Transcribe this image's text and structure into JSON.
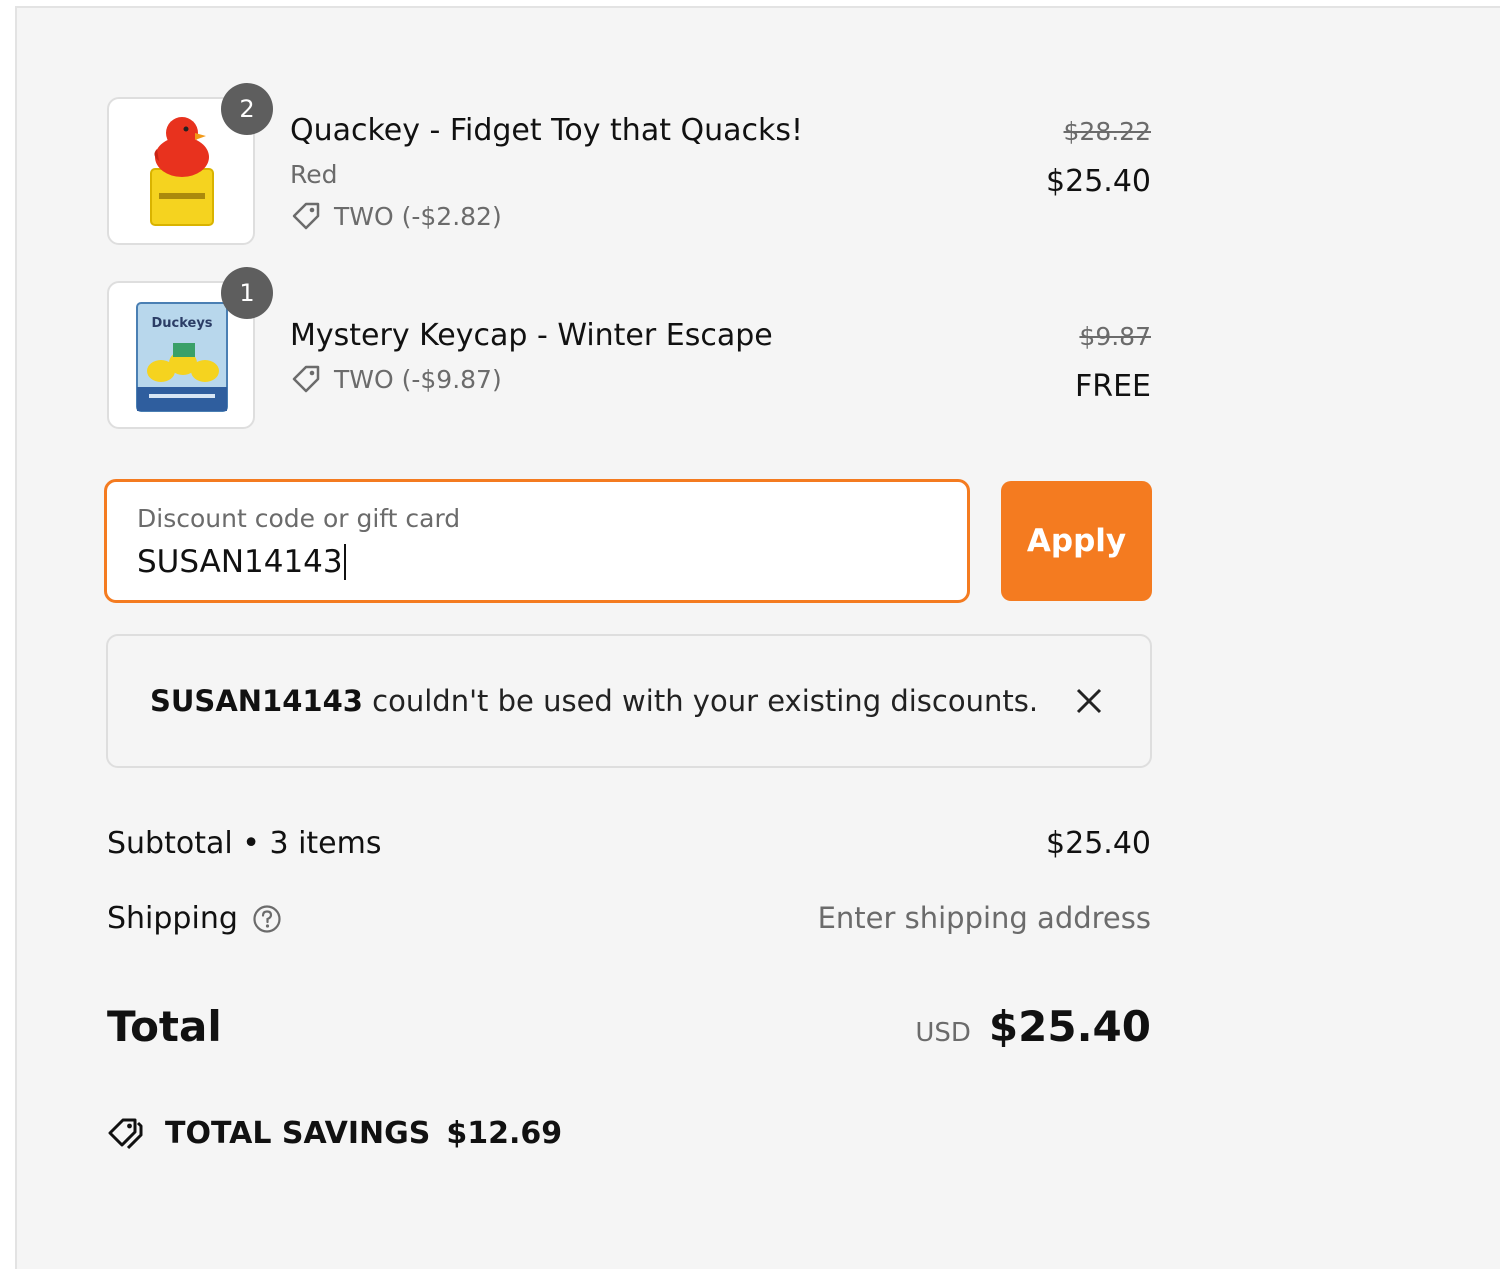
{
  "items": [
    {
      "title": "Quackey - Fidget Toy that Quacks!",
      "variant": "Red",
      "discount": "TWO (-$2.82)",
      "quantity": "2",
      "original_price": "$28.22",
      "price": "$25.40",
      "image": "red-duck-toy"
    },
    {
      "title": "Mystery Keycap - Winter Escape",
      "discount": "TWO (-$9.87)",
      "quantity": "1",
      "original_price": "$9.87",
      "price": "FREE",
      "image": "keycap-box"
    }
  ],
  "discount_field": {
    "label": "Discount code or gift card",
    "value": "SUSAN14143"
  },
  "apply_label": "Apply",
  "error": {
    "code": "SUSAN14143",
    "message": " couldn't be used with your existing discounts."
  },
  "summary": {
    "subtotal_label": "Subtotal • 3 items",
    "subtotal_value": "$25.40",
    "shipping_label": "Shipping",
    "shipping_value": "Enter shipping address",
    "total_label": "Total",
    "currency": "USD",
    "total_value": "$25.40",
    "savings_label": "TOTAL SAVINGS",
    "savings_value": "$12.69"
  },
  "colors": {
    "accent": "#f47b20",
    "background": "#f5f5f5",
    "badge": "#5e5e5e"
  }
}
